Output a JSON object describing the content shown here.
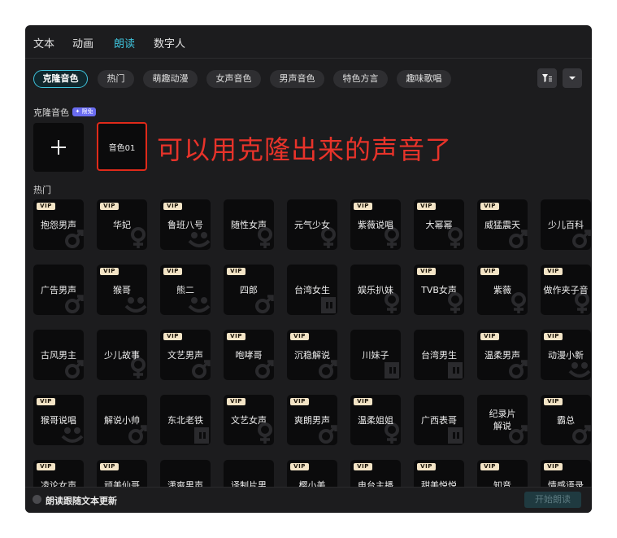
{
  "tabs": [
    {
      "label": "文本",
      "active": false
    },
    {
      "label": "动画",
      "active": false
    },
    {
      "label": "朗读",
      "active": true
    },
    {
      "label": "数字人",
      "active": false
    }
  ],
  "filters": [
    {
      "label": "克隆音色",
      "active": true
    },
    {
      "label": "热门",
      "active": false
    },
    {
      "label": "萌趣动漫",
      "active": false
    },
    {
      "label": "女声音色",
      "active": false
    },
    {
      "label": "男声音色",
      "active": false
    },
    {
      "label": "特色方言",
      "active": false
    },
    {
      "label": "趣味歌唱",
      "active": false
    }
  ],
  "clone_section": {
    "title": "克隆音色",
    "badge": "✦ 限免",
    "add_icon": "plus-icon",
    "voice": "音色01"
  },
  "annotation": "可以用克隆出来的声音了",
  "hot_section": {
    "title": "热门"
  },
  "vip_label": "VIP",
  "voices": [
    {
      "name": "抱怨男声",
      "vip": true,
      "wm": "male"
    },
    {
      "name": "华妃",
      "vip": true,
      "wm": "female"
    },
    {
      "name": "鲁班八号",
      "vip": true,
      "wm": "cartoon"
    },
    {
      "name": "随性女声",
      "vip": false,
      "wm": "female"
    },
    {
      "name": "元气少女",
      "vip": false,
      "wm": "female"
    },
    {
      "name": "紫薇说唱",
      "vip": true,
      "wm": "female"
    },
    {
      "name": "大幂幂",
      "vip": true,
      "wm": "female"
    },
    {
      "name": "威猛震天",
      "vip": true,
      "wm": "male"
    },
    {
      "name": "少儿百科",
      "vip": false,
      "wm": "male"
    },
    {
      "name": "广告男声",
      "vip": false,
      "wm": "male"
    },
    {
      "name": "猴哥",
      "vip": true,
      "wm": "cartoon"
    },
    {
      "name": "熊二",
      "vip": true,
      "wm": "cartoon"
    },
    {
      "name": "四郎",
      "vip": true,
      "wm": "male"
    },
    {
      "name": "台湾女生",
      "vip": false,
      "wm": "dialect"
    },
    {
      "name": "娱乐扒妹",
      "vip": false,
      "wm": "female"
    },
    {
      "name": "TVB女声",
      "vip": true,
      "wm": "female"
    },
    {
      "name": "紫薇",
      "vip": true,
      "wm": "female"
    },
    {
      "name": "做作夹子音",
      "vip": true,
      "wm": "female"
    },
    {
      "name": "古风男主",
      "vip": false,
      "wm": "male"
    },
    {
      "name": "少儿故事",
      "vip": false,
      "wm": "female"
    },
    {
      "name": "文艺男声",
      "vip": true,
      "wm": "male"
    },
    {
      "name": "咆哮哥",
      "vip": true,
      "wm": "male"
    },
    {
      "name": "沉稳解说",
      "vip": true,
      "wm": "male"
    },
    {
      "name": "川妹子",
      "vip": false,
      "wm": "dialect"
    },
    {
      "name": "台湾男生",
      "vip": false,
      "wm": "dialect"
    },
    {
      "name": "温柔男声",
      "vip": true,
      "wm": "male"
    },
    {
      "name": "动漫小新",
      "vip": true,
      "wm": "cartoon"
    },
    {
      "name": "猴哥说唱",
      "vip": true,
      "wm": "cartoon"
    },
    {
      "name": "解说小帅",
      "vip": false,
      "wm": "male"
    },
    {
      "name": "东北老铁",
      "vip": false,
      "wm": "dialect"
    },
    {
      "name": "文艺女声",
      "vip": true,
      "wm": "female"
    },
    {
      "name": "爽朗男声",
      "vip": true,
      "wm": "male"
    },
    {
      "name": "温柔姐姐",
      "vip": true,
      "wm": "female"
    },
    {
      "name": "广西表哥",
      "vip": false,
      "wm": "dialect"
    },
    {
      "name": "纪录片\n解说",
      "vip": false,
      "wm": "male"
    },
    {
      "name": "霸总",
      "vip": true,
      "wm": "male"
    },
    {
      "name": "凌论女声",
      "vip": true,
      "wm": "female"
    },
    {
      "name": "顽美仙哥",
      "vip": true,
      "wm": "male"
    },
    {
      "name": "潇爽男声",
      "vip": false,
      "wm": "male"
    },
    {
      "name": "译制片男",
      "vip": false,
      "wm": "male"
    },
    {
      "name": "樱小美",
      "vip": true,
      "wm": "female"
    },
    {
      "name": "电台主播",
      "vip": true,
      "wm": "female"
    },
    {
      "name": "甜美悦悦",
      "vip": true,
      "wm": "female"
    },
    {
      "name": "知音",
      "vip": true,
      "wm": "female"
    },
    {
      "name": "情感语录",
      "vip": true,
      "wm": "male"
    }
  ],
  "footer": {
    "checkbox_label": "朗读跟随文本更新",
    "start_button": "开始朗读"
  },
  "colors": {
    "accent": "#3fc3dc",
    "annotation": "#e8332a",
    "vip_badge": "#f3e4c6",
    "panel": "#1c1c1e"
  }
}
